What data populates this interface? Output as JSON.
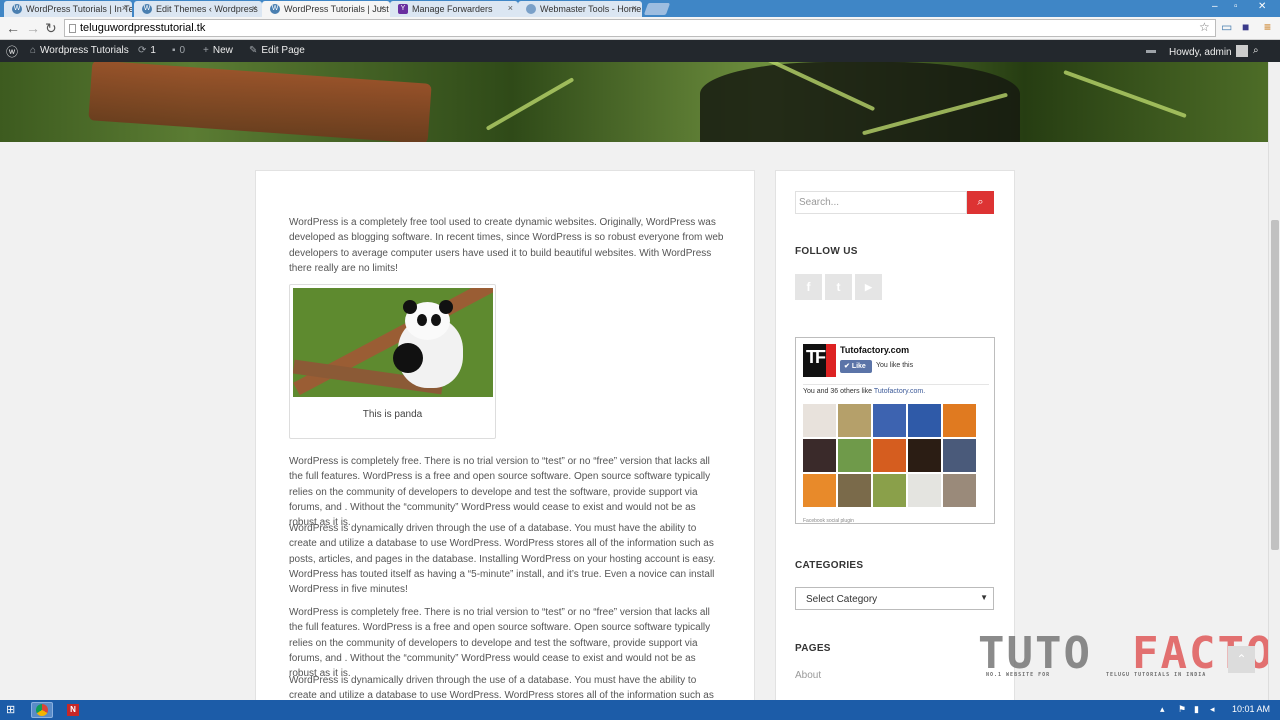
{
  "browser": {
    "tabs": [
      {
        "label": "WordPress Tutorials | In Te",
        "icon": "wordpress-icon",
        "active": false
      },
      {
        "label": "Edit Themes ‹ Wordpress",
        "icon": "wordpress-icon",
        "active": false
      },
      {
        "label": "WordPress Tutorials | Just",
        "icon": "wordpress-icon",
        "active": true
      },
      {
        "label": "Manage Forwarders",
        "icon": "yahoo-icon",
        "active": false
      },
      {
        "label": "Webmaster Tools - Home",
        "icon": "webmaster-icon",
        "active": false
      }
    ],
    "close_glyph": "×",
    "url": "teluguwordpresstutorial.tk"
  },
  "adminbar": {
    "site_name": "Wordpress Tutorials",
    "updates_count": "1",
    "comments_count": "0",
    "new_label": "New",
    "edit_label": "Edit Page",
    "howdy": "Howdy, admin"
  },
  "content": {
    "paragraphs": [
      "WordPress is a completely free tool used to create dynamic websites. Originally, WordPress was developed as blogging software. In recent times, since WordPress is so robust everyone from web developers to average computer users have used it to build beautiful websites. With WordPress there really are no limits!",
      "WordPress is completely free. There is no trial version to “test” or no “free” version that lacks all the full features. WordPress is a free and open source software. Open source software typically relies on the community of developers to develope and test the software, provide support via forums, and . Without the “community” WordPress would cease to exist and would not be as robust as it is.",
      "WordPress is dynamically driven through the use of a database. You must have the ability to create and utilize a database to use WordPress. WordPress stores all of the information such as posts, articles, and pages in the database. Installing WordPress on your hosting account is easy. WordPress has touted itself as having a “5-minute” install, and it’s true. Even a novice can install WordPress in five minutes!",
      "WordPress is completely free. There is no trial version to “test” or no “free” version that lacks all the full features. WordPress is a free and open source software. Open source software typically relies on the community of developers to develope and test the software, provide support via forums, and . Without the “community” WordPress would cease to exist and would not be as robust as it is.",
      "WordPress is dynamically driven through the use of a database. You must have the ability to create and utilize a database to use WordPress. WordPress stores all of the information such as posts,"
    ],
    "image_caption": "This is panda"
  },
  "sidebar": {
    "search_placeholder": "Search...",
    "follow_title": "FOLLOW US",
    "social": [
      {
        "icon": "facebook-icon",
        "glyph": "f"
      },
      {
        "icon": "twitter-icon",
        "glyph": "t"
      },
      {
        "icon": "youtube-icon",
        "glyph": "▶"
      }
    ],
    "fb": {
      "page_name": "Tutofactory.com",
      "like_label": "Like",
      "you_like": "You like this",
      "others_prefix": "You and 36 others like ",
      "others_site": "Tutofactory.com.",
      "footer": "Facebook social plugin"
    },
    "categories_title": "CATEGORIES",
    "category_select": "Select Category",
    "pages_title": "PAGES",
    "pages": [
      "About"
    ]
  },
  "watermark": {
    "word1": "TUTO",
    "word2": "FACTORY",
    "sub1": "NO.1 WEBSITE FOR",
    "sub2": "TELUGU TUTORIALS IN INDIA"
  },
  "taskbar": {
    "time": "10:01 AM"
  },
  "colors": {
    "accent": "#dd3333",
    "adminbar": "#23282d",
    "tabstrip": "#3f86c6",
    "taskbar": "#1c5ca8"
  }
}
